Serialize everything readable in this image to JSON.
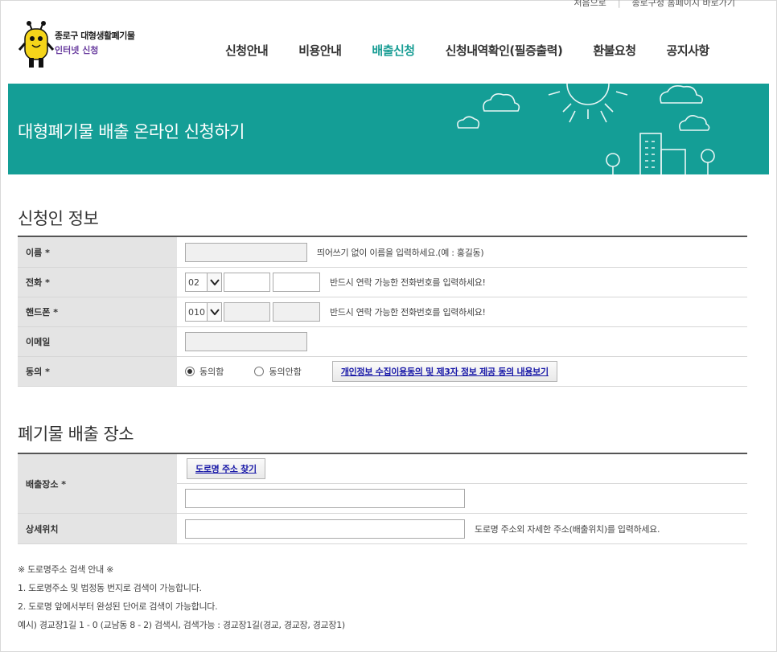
{
  "util": {
    "home": "처음으로",
    "office": "종로구청 홈페이지 바로가기"
  },
  "logo": {
    "title": "종로구 대형생활폐기물",
    "subtitle": "인터넷 신청"
  },
  "nav": [
    {
      "label": "신청안내",
      "active": false
    },
    {
      "label": "비용안내",
      "active": false
    },
    {
      "label": "배출신청",
      "active": true
    },
    {
      "label": "신청내역확인(필증출력)",
      "active": false
    },
    {
      "label": "환불요청",
      "active": false
    },
    {
      "label": "공지사항",
      "active": false
    }
  ],
  "banner": {
    "title": "대형폐기물 배출 온라인 신청하기"
  },
  "applicant": {
    "section_title": "신청인 정보",
    "name": {
      "label": "이름  *",
      "hint": "띄어쓰기 없이 이름을 입력하세요.(예 : 홍길동)"
    },
    "phone": {
      "label": "전화  *",
      "area": "02",
      "hint": "반드시 연락 가능한 전화번호를 입력하세요!"
    },
    "mobile": {
      "label": "핸드폰  *",
      "prefix": "010",
      "hint": "반드시 연락 가능한 전화번호를 입력하세요!"
    },
    "email": {
      "label": "이메일"
    },
    "consent": {
      "label": "동의  *",
      "agree": "동의함",
      "disagree": "동의안함",
      "view_button": "개인정보 수집이용동의 및 제3자 정보 제공 동의 내용보기"
    }
  },
  "location": {
    "section_title": "폐기물 배출 장소",
    "place": {
      "label": "배출장소 *",
      "search_button": "도로명 주소 찾기"
    },
    "detail": {
      "label": "상세위치",
      "hint": "도로명 주소외 자세한 주소(배출위치)를 입력하세요."
    }
  },
  "notes": [
    "※ 도로명주소 검색 안내 ※",
    "1. 도로명주소 및 법정동 번지로 검색이 가능합니다.",
    "2. 도로명 앞에서부터 완성된 단어로 검색이 가능합니다.",
    "예시) 경교장1길 1 - 0 (교남동 8 - 2) 검색시, 검색가능 : 경교장1길(경교, 경교장, 경교장1)"
  ],
  "colors": {
    "accent": "#149e96",
    "nav_active": "#1a9e95"
  }
}
